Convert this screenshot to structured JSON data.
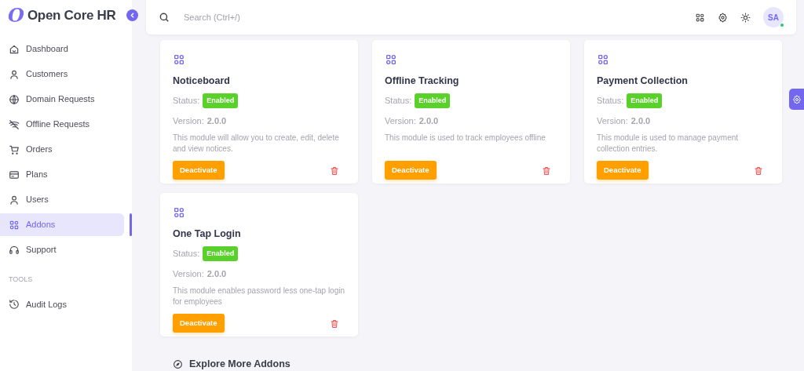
{
  "sidebar": {
    "logo_mark": "O",
    "logo_text": "Open Core HR",
    "groups": [
      {
        "items": [
          {
            "label": "Dashboard",
            "selected": false
          },
          {
            "label": "Customers",
            "selected": false
          },
          {
            "label": "Domain Requests",
            "selected": false
          },
          {
            "label": "Offline Requests",
            "selected": false
          },
          {
            "label": "Orders",
            "selected": false
          },
          {
            "label": "Plans",
            "selected": false
          },
          {
            "label": "Users",
            "selected": false
          },
          {
            "label": "Addons",
            "selected": true
          },
          {
            "label": "Support",
            "selected": false
          }
        ]
      },
      {
        "heading": "TOOLS",
        "items": [
          {
            "label": "Audit Logs",
            "selected": false
          }
        ]
      }
    ]
  },
  "topbar": {
    "search": {
      "placeholder": "Search (Ctrl+/)"
    },
    "avatar": {
      "initials": "SA",
      "online": true
    }
  },
  "addons": [
    {
      "name": "Noticeboard",
      "status_label": "Status:",
      "status": "Enabled",
      "version_label": "Version:",
      "version": "2.0.0",
      "description": "This module will allow you to create, edit, delete and view notices.",
      "action": "Deactivate"
    },
    {
      "name": "Offline Tracking",
      "status_label": "Status:",
      "status": "Enabled",
      "version_label": "Version:",
      "version": "2.0.0",
      "description": "This module is used to track employees offline",
      "action": "Deactivate"
    },
    {
      "name": "Payment Collection",
      "status_label": "Status:",
      "status": "Enabled",
      "version_label": "Version:",
      "version": "2.0.0",
      "description": "This module is used to manage payment collection entries.",
      "action": "Deactivate"
    },
    {
      "name": "One Tap Login",
      "status_label": "Status:",
      "status": "Enabled",
      "version_label": "Version:",
      "version": "2.0.0",
      "description": "This module enables password less one-tap login for employees",
      "action": "Deactivate"
    }
  ],
  "explore": {
    "title": "Explore More Addons"
  }
}
